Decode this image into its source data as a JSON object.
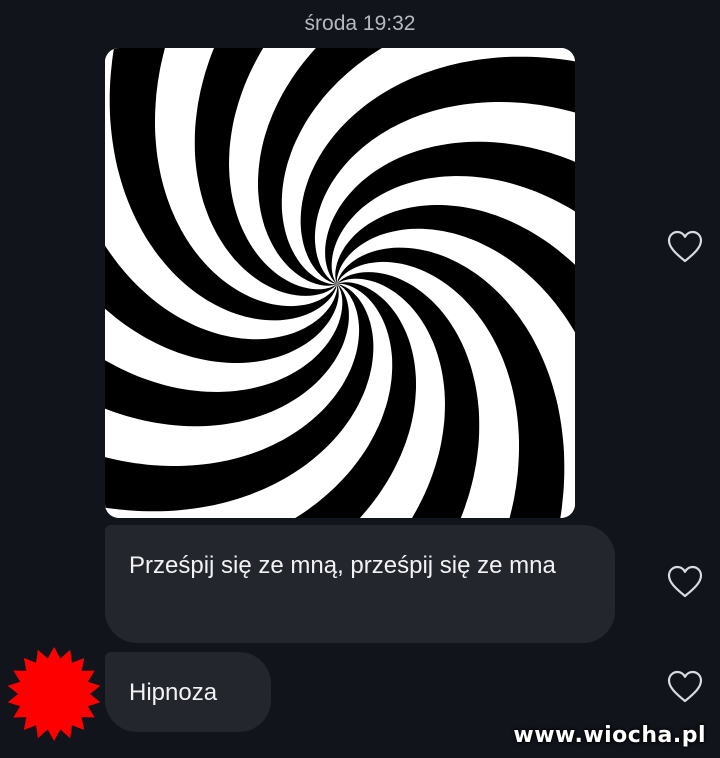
{
  "conversation": {
    "timestamp": "środa 19:32",
    "image_message": {
      "image": "hypnotic-spiral-image"
    },
    "messages": [
      {
        "text": "Prześpij się ze mną, prześpij się ze mna",
        "liked": false
      },
      {
        "text": "Hipnoza",
        "liked": false
      }
    ]
  },
  "icons": {
    "like": "heart-outline-icon",
    "avatar": "red-starburst-avatar"
  },
  "watermark": "www.wiocha.pl",
  "colors": {
    "background": "#12141c",
    "bubble": "#24262e",
    "text": "#f2f2f4",
    "timestamp": "#b7b9c0",
    "avatar": "#ff0000"
  }
}
